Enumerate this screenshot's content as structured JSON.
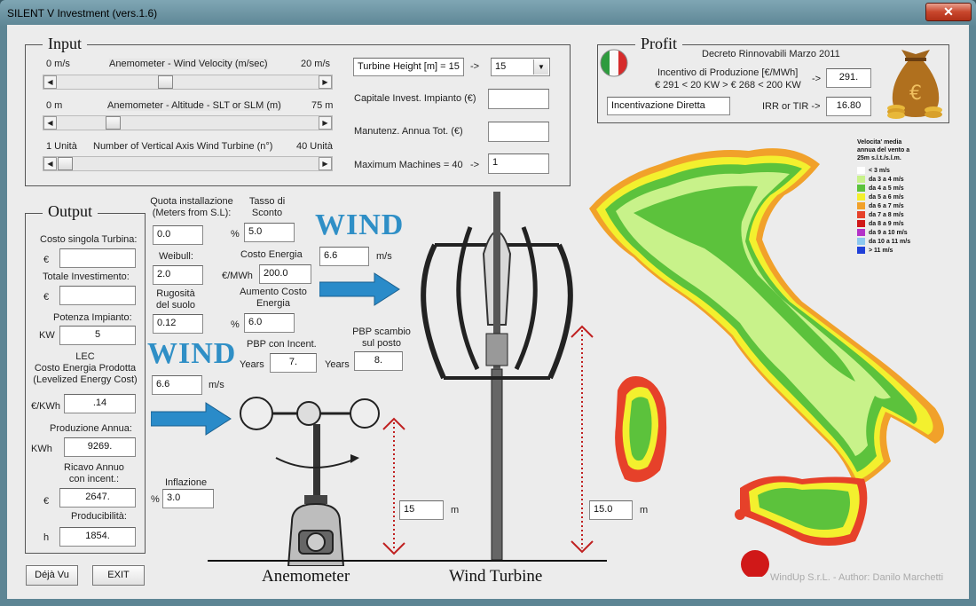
{
  "window": {
    "title": "SILENT V Investment  (vers.1.6)",
    "close_label": "✕"
  },
  "input": {
    "title": "Input",
    "velocity": {
      "min": "0 m/s",
      "label": "Anemometer - Wind Velocity (m/sec)",
      "max": "20 m/s",
      "value_fraction": 0.42
    },
    "altitude": {
      "min": "0 m",
      "label": "Anemometer - Altitude - SLT or SLM (m)",
      "max": "75 m",
      "value_fraction": 0.23
    },
    "units": {
      "min": "1 Unità",
      "label": "Number of Vertical Axis Wind Turbine  (n°)",
      "max": "40 Unità",
      "value_fraction": 0.03
    },
    "turbine_height_label": "Turbine Height [m] = 15",
    "arrow": "->",
    "turbine_height_value": "15",
    "capitale_label": "Capitale Invest. Impianto (€)",
    "capitale_value": "",
    "manutenz_label": "Manutenz. Annua Tot. (€)",
    "manutenz_value": "",
    "max_machines_label": "Maximum Machines = 40",
    "max_machines_value": "1"
  },
  "profit": {
    "title": "Profit",
    "decreto": "Decreto Rinnovabili Marzo 2011",
    "incentivo_label": "Incentivo di Produzione [€/MWh]",
    "incentivo_range": "€ 291 < 20 KW > € 268 < 200 KW",
    "incentivo_value": "291.",
    "incentivazione": "Incentivazione Diretta",
    "irr_label": "IRR or TIR ->",
    "irr_value": "16.80",
    "arrow": "->",
    "colors": {
      "flag_green": "#2e9b3e",
      "flag_red": "#d62b2b",
      "bag": "#b0701e"
    }
  },
  "output": {
    "title": "Output",
    "costo_turbina_label": "Costo singola Turbina:",
    "costo_turbina_unit": "€",
    "costo_turbina_value": "",
    "totale_label": "Totale Investimento:",
    "totale_unit": "€",
    "totale_value": "",
    "potenza_label": "Potenza Impianto:",
    "potenza_unit": "KW",
    "potenza_value": "5",
    "lec_line1": "LEC",
    "lec_line2": "Costo Energia Prodotta",
    "lec_line3": "(Levelized Energy Cost)",
    "lec_unit": "€/KWh",
    "lec_value": ".14",
    "produzione_label": "Produzione Annua:",
    "produzione_unit": "KWh",
    "produzione_value": "9269.",
    "ricavo_line1": "Ricavo Annuo",
    "ricavo_line2": "con incent.:",
    "ricavo_unit": "€",
    "ricavo_value": "2647.",
    "producibilita_label": "Producibilità:",
    "producibilita_unit": "h",
    "producibilita_value": "1854."
  },
  "params": {
    "quota_line1": "Quota installazione",
    "quota_line2": "(Meters from S.L):",
    "quota_value": "0.0",
    "tasso_line1": "Tasso di",
    "tasso_line2": "Sconto",
    "tasso_unit": "%",
    "tasso_value": "5.0",
    "weibull_label": "Weibull:",
    "weibull_value": "2.0",
    "costo_energia_label": "Costo Energia",
    "costo_energia_unit": "€/MWh",
    "costo_energia_value": "200.0",
    "rugosita_line1": "Rugosità",
    "rugosita_line2": "del suolo",
    "rugosita_value": "0.12",
    "aumento_line1": "Aumento Costo",
    "aumento_line2": "Energia",
    "aumento_unit": "%",
    "aumento_value": "6.0",
    "pbp_incent_label": "PBP con Incent.",
    "pbp_incent_unit": "Years",
    "pbp_incent_value": "7.",
    "pbp_scambio_line1": "PBP scambio",
    "pbp_scambio_line2": "sul posto",
    "pbp_scambio_unit": "Years",
    "pbp_scambio_value": "8.",
    "inflazione_label": "Inflazione",
    "inflazione_unit": "%",
    "inflazione_value": "3.0"
  },
  "wind": {
    "word": "WIND",
    "top_value": "6.6",
    "top_unit": "m/s",
    "low_value": "6.6",
    "low_unit": "m/s",
    "anemometer_height": "15",
    "turbine_height": "15.0",
    "height_unit": "m",
    "color": "#2f8fc6"
  },
  "captions": {
    "anemometer": "Anemometer",
    "turbine": "Wind Turbine"
  },
  "map_legend": {
    "title_line1": "Velocita' media",
    "title_line2": "annua del vento a",
    "title_line3": "25m s.l.t./s.l.m.",
    "items": [
      {
        "color": "#ffffff",
        "label": "< 3 m/s"
      },
      {
        "color": "#c8f28a",
        "label": "da 3 a 4 m/s"
      },
      {
        "color": "#5cc23c",
        "label": "da 4 a 5 m/s"
      },
      {
        "color": "#f3f02e",
        "label": "da 5 a 6 m/s"
      },
      {
        "color": "#f1a12a",
        "label": "da 6 a 7 m/s"
      },
      {
        "color": "#e6412a",
        "label": "da 7 a 8 m/s"
      },
      {
        "color": "#d01818",
        "label": "da 8 a 9 m/s"
      },
      {
        "color": "#b432c8",
        "label": "da 9 a 10 m/s"
      },
      {
        "color": "#8cc8f0",
        "label": "da 10 a 11 m/s"
      },
      {
        "color": "#2040d8",
        "label": "> 11 m/s"
      }
    ]
  },
  "buttons": {
    "dejavu": "Déjà Vu",
    "exit": "EXIT"
  },
  "footer": "WindUp S.r.L. - Author: Danilo Marchetti"
}
